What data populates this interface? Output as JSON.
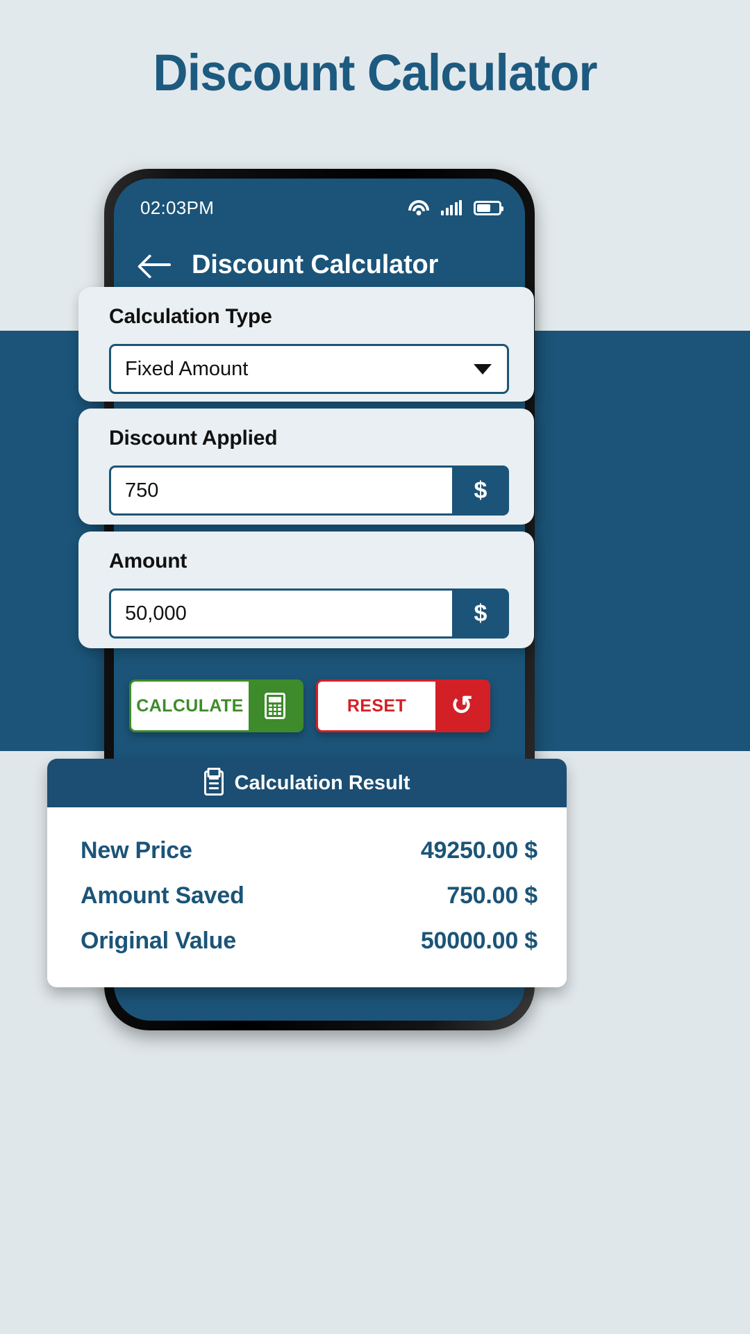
{
  "page": {
    "title": "Discount Calculator",
    "accent_color": "#1b5478",
    "background_color": "#e2e9ec"
  },
  "phone": {
    "statusbar": {
      "time": "02:03PM",
      "icons": [
        "wifi-icon",
        "signal-bars-icon",
        "battery-icon"
      ]
    },
    "appbar": {
      "back_icon": "arrow-left-icon",
      "title": "Discount Calculator"
    }
  },
  "form": {
    "calculation_type": {
      "label": "Calculation Type",
      "value": "Fixed Amount",
      "caret_icon": "chevron-down-icon"
    },
    "discount_applied": {
      "label": "Discount Applied",
      "value": "750",
      "unit": "$"
    },
    "amount": {
      "label": "Amount",
      "value": "50,000",
      "unit": "$"
    }
  },
  "actions": {
    "calculate": {
      "label": "CALCULATE",
      "icon": "calculator-icon",
      "color": "#3d8b2a"
    },
    "reset": {
      "label": "RESET",
      "icon": "reset-icon",
      "glyph": "↺",
      "color": "#d32027"
    }
  },
  "result": {
    "header": "Calculation Result",
    "header_icon": "clipboard-check-icon",
    "rows": [
      {
        "key": "New Price",
        "value": "49250.00 $"
      },
      {
        "key": "Amount Saved",
        "value": "750.00 $"
      },
      {
        "key": "Original Value",
        "value": "50000.00 $"
      }
    ]
  }
}
